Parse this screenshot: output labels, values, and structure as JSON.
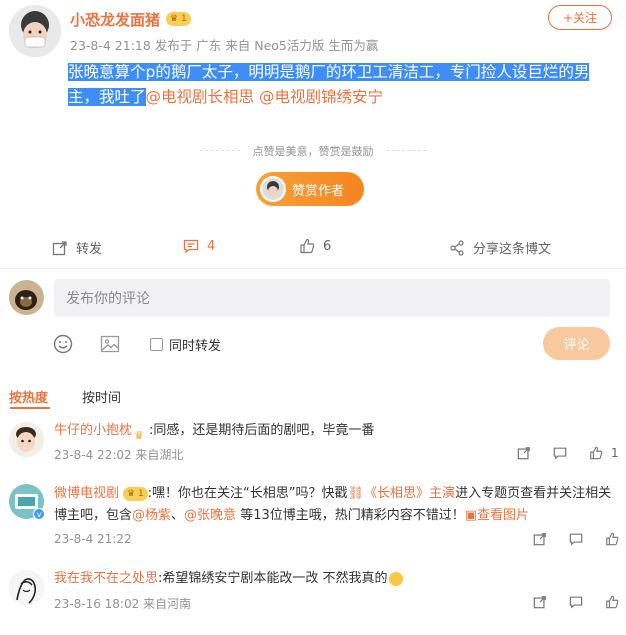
{
  "post": {
    "author": "小恐龙发面猪",
    "follow_label": "+关注",
    "meta": "23-8-4 21:18  发布于 广东  来自 Neo5活力版 生而为赢",
    "text_highlight": "张晚意算个p的鹅厂太子，明明是鹅厂的环卫工清洁工，专门捡人设巨烂的男主，我吐了",
    "mention1": "@电视剧长相思",
    "mention2": "@电视剧锦绣安宁",
    "tip": "点赞是美意，赞赏是鼓励",
    "reward_label": "赞赏作者",
    "actions": {
      "repost": "转发",
      "comment_count": "4",
      "like_count": "6",
      "share": "分享这条博文"
    }
  },
  "composer": {
    "placeholder": "发布你的评论",
    "repost_checkbox_label": "同时转发",
    "submit_label": "评论"
  },
  "tabs": {
    "hot": "按热度",
    "time": "按时间"
  },
  "comments": [
    {
      "name": "牛仔的小抱枕",
      "text": ":同感，还是期待后面的剧吧，毕竟一番",
      "meta": "23-8-4 22:02 来自湖北",
      "like_count": "1"
    },
    {
      "name": "微博电视剧",
      "text_a": ":嘿！你也在关注“长相思”吗？快戳",
      "link": "《长相思》主演",
      "text_b": "进入专题页查看并关注相关博主吧，包含",
      "m1": "@杨紫",
      "sep": "、",
      "m2": "@张晚意",
      "text_c": " 等13位博主哦，热门精彩内容不错过！",
      "pic_link": "查看图片",
      "meta": "23-8-4 21:22"
    },
    {
      "name": "我在我不在之处思",
      "text": ":希望锦绣安宁剧本能改一改 不然我真的",
      "meta": "23-8-16 18:02 来自河南"
    }
  ]
}
